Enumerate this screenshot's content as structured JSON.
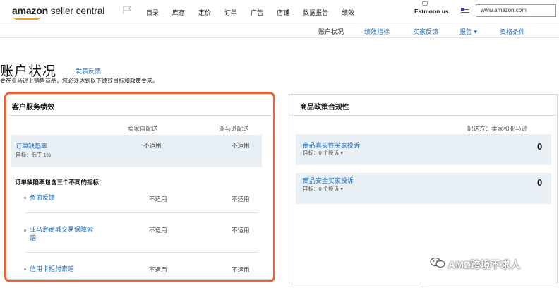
{
  "header": {
    "logo_prefix": "amazon",
    "logo_suffix": " seller central",
    "nav": [
      "目录",
      "库存",
      "定价",
      "订单",
      "广告",
      "店铺",
      "数据报告",
      "绩效"
    ],
    "store_name": "Estmoon us",
    "domain": "www.amazon.com"
  },
  "subnav": {
    "current": "账户状况",
    "links": [
      "绩效指标",
      "买家反馈",
      "报告 ▾",
      "资格条件"
    ]
  },
  "page": {
    "title": "账户状况",
    "feedback_link": "发表反馈",
    "subtitle": "要在亚马逊上销售商品，您必须达到以下绩效目标和政策要求。"
  },
  "customer_service": {
    "heading": "客户服务绩效",
    "col_merchant": "卖家自配送",
    "col_amazon": "亚马逊配送",
    "odr": {
      "label": "订单缺陷率",
      "target": "目标：低于 1%",
      "merchant": "不适用",
      "amazon": "不适用"
    },
    "odr_note": "订单缺陷率包含三个不同的指标：",
    "metrics": [
      {
        "label": "负面反馈",
        "merchant": "不适用",
        "amazon": "不适用"
      },
      {
        "label_line1": "亚马逊商城交易保障索",
        "label_line2": "赔",
        "merchant": "不适用",
        "amazon": "不适用"
      },
      {
        "label": "信用卡拒付索赔",
        "merchant": "不适用",
        "amazon": "不适用"
      }
    ]
  },
  "policy": {
    "heading": "商品政策合规性",
    "ship_label": "配送方：卖家和亚马逊",
    "rows": [
      {
        "label": "商品真实性买家投诉",
        "target": "目标：0 个投诉 ▾",
        "count": "0"
      },
      {
        "label": "商品安全买家投诉",
        "target": "目标：0 个投诉 ▾",
        "count": "0"
      }
    ]
  },
  "watermark": {
    "text": "AMZ跨境不求人"
  },
  "icons": [
    "flag-icon",
    "us-flag-icon",
    "wechat-icon",
    "chevron-down-icon"
  ]
}
